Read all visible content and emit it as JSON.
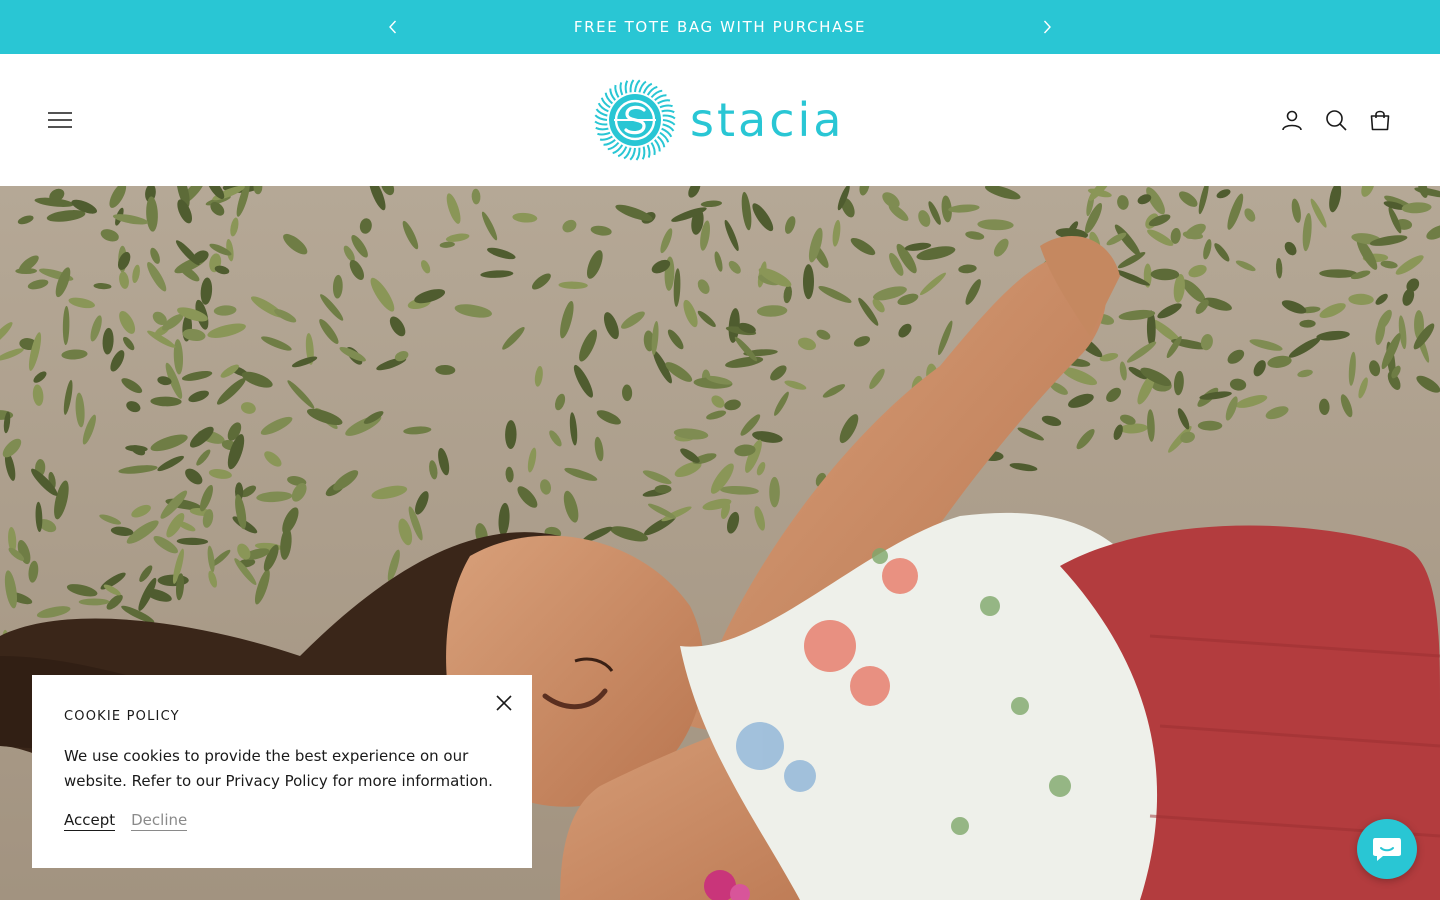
{
  "announcement": {
    "text": "FREE TOTE BAG WITH PURCHASE",
    "prev_icon": "chevron-left-icon",
    "next_icon": "chevron-right-icon"
  },
  "header": {
    "logo_text": "stacia",
    "menu_icon": "hamburger-menu-icon",
    "icons": [
      "account-icon",
      "search-icon",
      "shopping-bag-icon"
    ]
  },
  "hero": {
    "image": "woman lying in sand among succulent plants"
  },
  "cookie": {
    "title": "COOKIE POLICY",
    "text": "We use cookies to provide the best experience on our website. Refer to our Privacy Policy for more information.",
    "accept_label": "Accept",
    "decline_label": "Decline",
    "close_icon": "close-icon"
  },
  "chat": {
    "icon": "chat-bubble-icon"
  },
  "colors": {
    "brand": "#29c6d4",
    "text": "#1a1a1a",
    "muted": "#8a8a8a",
    "background": "#ffffff"
  }
}
